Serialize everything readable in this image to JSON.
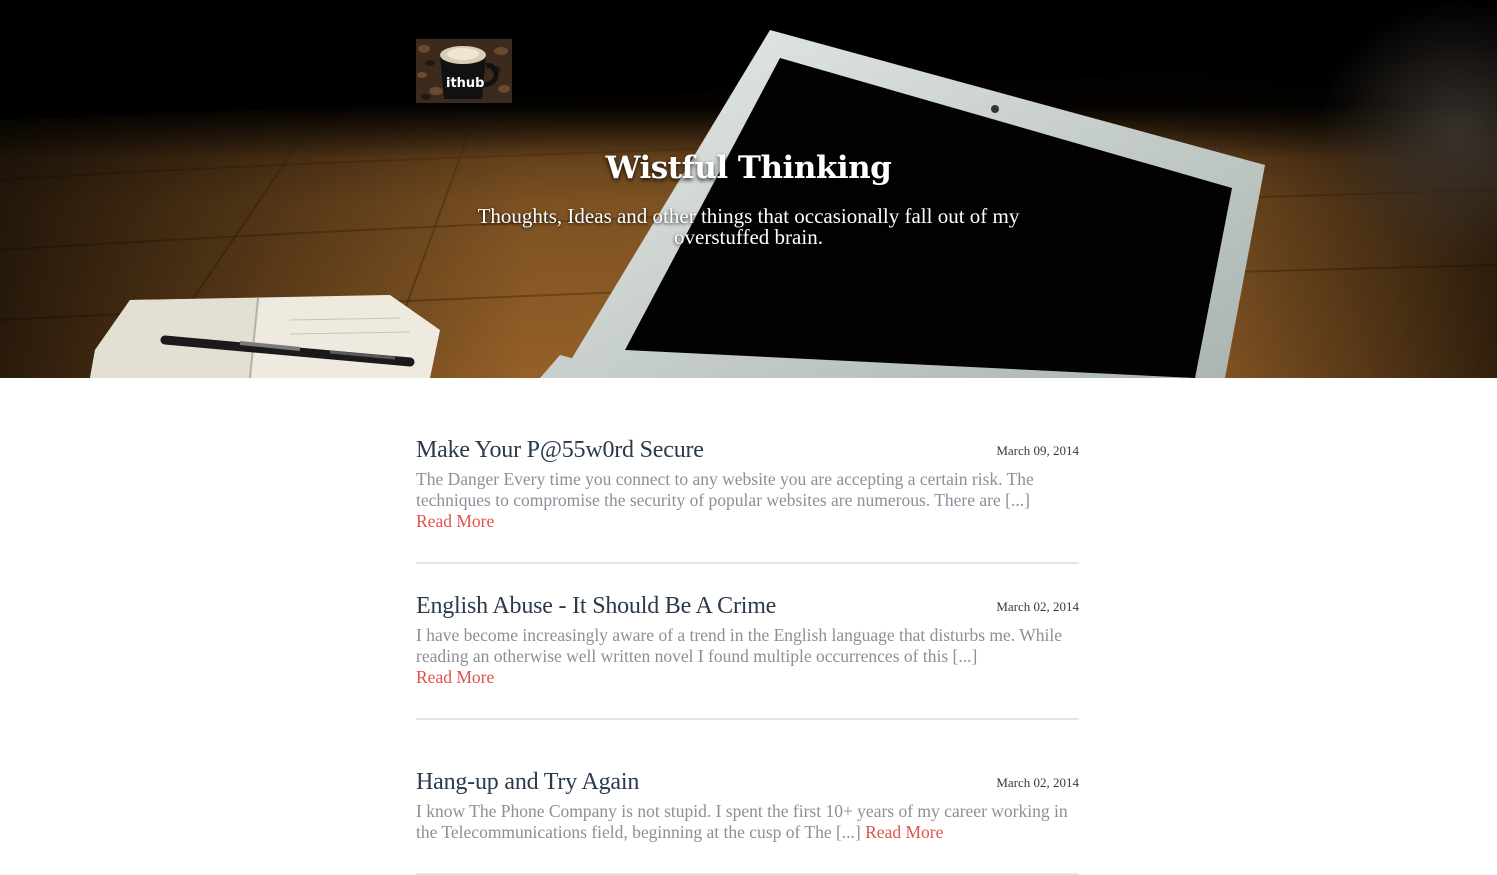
{
  "header": {
    "logo_alt": "github coffee mug",
    "logo_text": "ithub",
    "title": "Wistful Thinking",
    "tagline": "Thoughts, Ideas and other things that occasionally fall out of my overstuffed brain."
  },
  "posts": [
    {
      "title": "Make Your P@55w0rd Secure",
      "date": "March 09, 2014",
      "excerpt": "The Danger Every time you connect to any website you are accepting a certain risk. The techniques to compromise the security of popular websites are numerous. There are [...]",
      "read_more": "Read More"
    },
    {
      "title": "English Abuse - It Should Be A Crime",
      "date": "March 02, 2014",
      "excerpt": "I have become increasingly aware of a trend in the English language that disturbs me. While reading an otherwise well written novel I found multiple occurrences of this [...]",
      "read_more": "Read More"
    },
    {
      "title": "Hang-up and Try Again",
      "date": "March 02, 2014",
      "excerpt": "I know The Phone Company is not stupid. I spent the first 10+ years of my career working in the Telecommunications field, beginning at the cusp of The [...]",
      "read_more": "Read More"
    }
  ],
  "colors": {
    "title": "#2b3a4a",
    "excerpt": "#8a8f98",
    "link": "#e0524c",
    "divider": "#e4e4e4"
  }
}
